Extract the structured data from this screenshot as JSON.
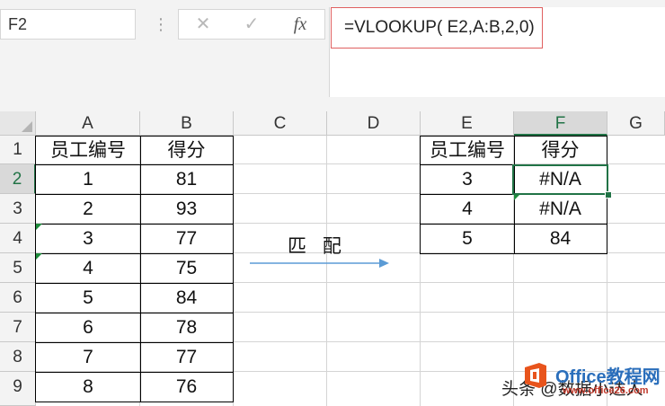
{
  "name_box": {
    "value": "F2"
  },
  "formula_bar": {
    "more": "⋮",
    "cancel": "✕",
    "enter": "✓",
    "fx": "fx",
    "formula": "=VLOOKUP( E2,A:B,2,0)"
  },
  "columns": [
    "A",
    "B",
    "C",
    "D",
    "E",
    "F",
    "G"
  ],
  "rows": [
    "1",
    "2",
    "3",
    "4",
    "5",
    "6",
    "7",
    "8",
    "9"
  ],
  "table1": {
    "headers": [
      "员工编号",
      "得分"
    ],
    "rows": [
      [
        "1",
        "81"
      ],
      [
        "2",
        "93"
      ],
      [
        "3",
        "77"
      ],
      [
        "4",
        "75"
      ],
      [
        "5",
        "84"
      ],
      [
        "6",
        "78"
      ],
      [
        "7",
        "77"
      ],
      [
        "8",
        "76"
      ]
    ]
  },
  "table2": {
    "headers": [
      "员工编号",
      "得分"
    ],
    "rows": [
      [
        "3",
        "#N/A"
      ],
      [
        "4",
        "#N/A"
      ],
      [
        "5",
        "84"
      ]
    ]
  },
  "annotation": {
    "label": "匹 配"
  },
  "watermark": {
    "text": "头条 @数据小达人",
    "brand": "Office教程网",
    "site": "www.office26.com"
  },
  "colors": {
    "accent": "#217346",
    "arrow": "#5b9bd5",
    "formula_border": "#e06060"
  }
}
